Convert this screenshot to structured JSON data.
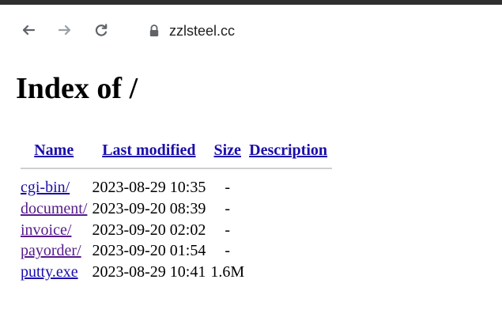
{
  "browser": {
    "url": "zzlsteel.cc",
    "back_icon": "arrow-left-icon",
    "forward_icon": "arrow-right-icon",
    "reload_icon": "reload-icon",
    "lock_icon": "lock-icon"
  },
  "page": {
    "title": "Index of /",
    "headers": {
      "name": "Name",
      "last_modified": "Last modified",
      "size": "Size",
      "description": "Description"
    },
    "rows": [
      {
        "name": "cgi-bin/",
        "modified": "2023-08-29 10:35",
        "size": "-",
        "description": ""
      },
      {
        "name": "document/",
        "modified": "2023-09-20 08:39",
        "size": "-",
        "description": ""
      },
      {
        "name": "invoice/",
        "modified": "2023-09-20 02:02",
        "size": "-",
        "description": ""
      },
      {
        "name": "payorder/",
        "modified": "2023-09-20 01:54",
        "size": "-",
        "description": ""
      },
      {
        "name": "putty.exe",
        "modified": "2023-08-29 10:41",
        "size": "1.6M",
        "description": ""
      }
    ]
  },
  "colors": {
    "link": "#1a0dab",
    "visited_link": "#551a8b",
    "chrome_edge": "#2f2f2f",
    "rule": "#cfcfcf"
  }
}
